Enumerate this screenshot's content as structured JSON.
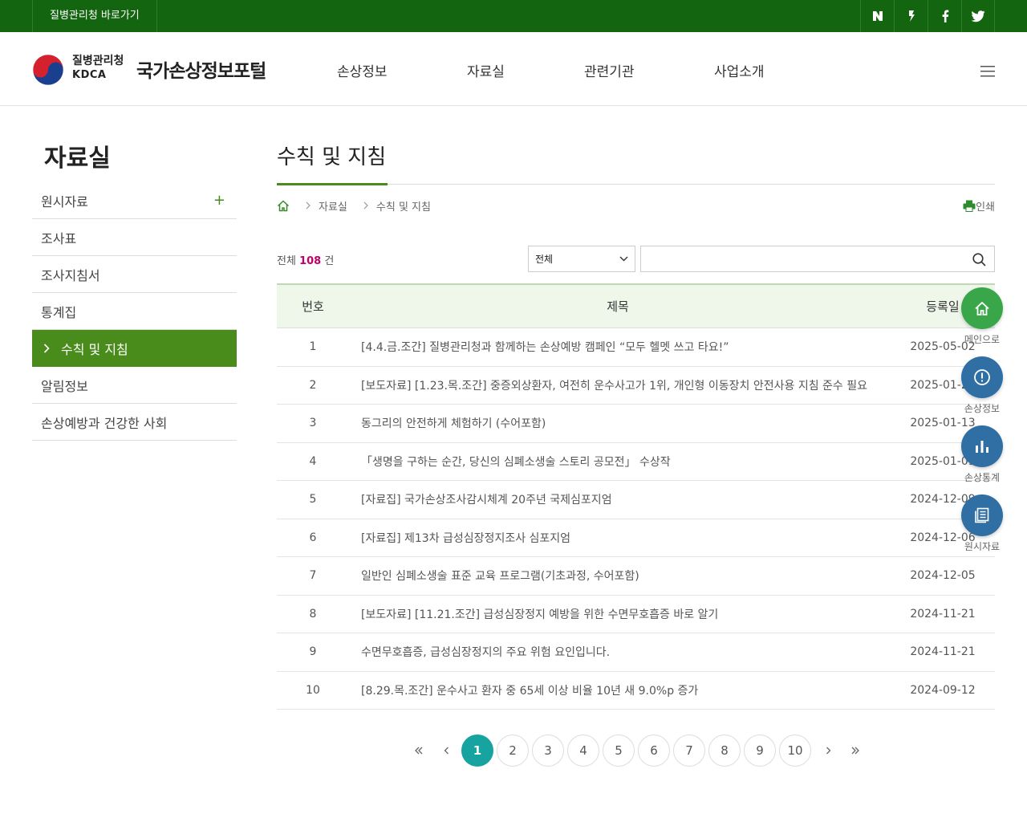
{
  "topbar": {
    "link": "질병관리청 바로가기",
    "sns": [
      "naver-blog-icon",
      "kakao-story-icon",
      "facebook-icon",
      "twitter-icon"
    ]
  },
  "header": {
    "org_name": "질병관리청",
    "org_abbr": "KDCA",
    "site_title": "국가손상정보포털",
    "nav": [
      "손상정보",
      "자료실",
      "관련기관",
      "사업소개"
    ]
  },
  "sidebar": {
    "title": "자료실",
    "items": [
      {
        "label": "원시자료",
        "expand": "+"
      },
      {
        "label": "조사표"
      },
      {
        "label": "조사지침서"
      },
      {
        "label": "통계집"
      },
      {
        "label": "수칙 및 지침",
        "active": true
      },
      {
        "label": "알림정보"
      },
      {
        "label": "손상예방과 건강한 사회"
      }
    ]
  },
  "content": {
    "page_title": "수칙 및 지침",
    "breadcrumb": [
      "자료실",
      "수칙 및 지침"
    ],
    "print_label": "인쇄",
    "total_prefix": "전체",
    "total_count": "108",
    "total_suffix": "건",
    "search": {
      "select_value": "전체",
      "input_value": ""
    },
    "table": {
      "headers": [
        "번호",
        "제목",
        "등록일"
      ],
      "rows": [
        {
          "no": "1",
          "title": "[4.4.금.조간] 질병관리청과 함께하는 손상예방 캠페인 “모두 헬멧 쓰고 타요!”",
          "date": "2025-05-02"
        },
        {
          "no": "2",
          "title": "[보도자료] [1.23.목.조간] 중증외상환자, 여전히 운수사고가 1위, 개인형 이동장치 안전사용 지침 준수 필요",
          "date": "2025-01-22"
        },
        {
          "no": "3",
          "title": "동그리의 안전하게 체험하기 (수어포함)",
          "date": "2025-01-13"
        },
        {
          "no": "4",
          "title": "「생명을 구하는 순간, 당신의 심폐소생술 스토리 공모전」 수상작",
          "date": "2025-01-09"
        },
        {
          "no": "5",
          "title": "[자료집] 국가손상조사감시체계 20주년 국제심포지엄",
          "date": "2024-12-09"
        },
        {
          "no": "6",
          "title": "[자료집] 제13차 급성심장정지조사 심포지엄",
          "date": "2024-12-06"
        },
        {
          "no": "7",
          "title": "일반인 심폐소생술 표준 교육 프로그램(기초과정, 수어포함)",
          "date": "2024-12-05"
        },
        {
          "no": "8",
          "title": "[보도자료] [11.21.조간] 급성심장정지 예방을 위한 수면무호흡증 바로 알기",
          "date": "2024-11-21"
        },
        {
          "no": "9",
          "title": "수면무호흡증, 급성심장정지의 주요 위험 요인입니다.",
          "date": "2024-11-21"
        },
        {
          "no": "10",
          "title": "[8.29.목.조간] 운수사고 환자 중 65세 이상 비율 10년 새 9.0%p 증가",
          "date": "2024-09-12"
        }
      ]
    },
    "pagination": {
      "pages": [
        "1",
        "2",
        "3",
        "4",
        "5",
        "6",
        "7",
        "8",
        "9",
        "10"
      ],
      "current": "1"
    }
  },
  "quick_menu": [
    {
      "label": "메인으로",
      "icon": "home-icon",
      "color": "#3aa64a"
    },
    {
      "label": "손상정보",
      "icon": "info-icon",
      "color": "#2f6fa3"
    },
    {
      "label": "손상통계",
      "icon": "bar-chart-icon",
      "color": "#2f6fa3"
    },
    {
      "label": "원시자료",
      "icon": "document-icon",
      "color": "#2f6fa3"
    }
  ],
  "colors": {
    "topbar": "#14650f",
    "accent_green": "#4a8c1c",
    "total_count": "#c0006a",
    "current_page": "#17a3a0",
    "table_header": "#eff6ea"
  }
}
